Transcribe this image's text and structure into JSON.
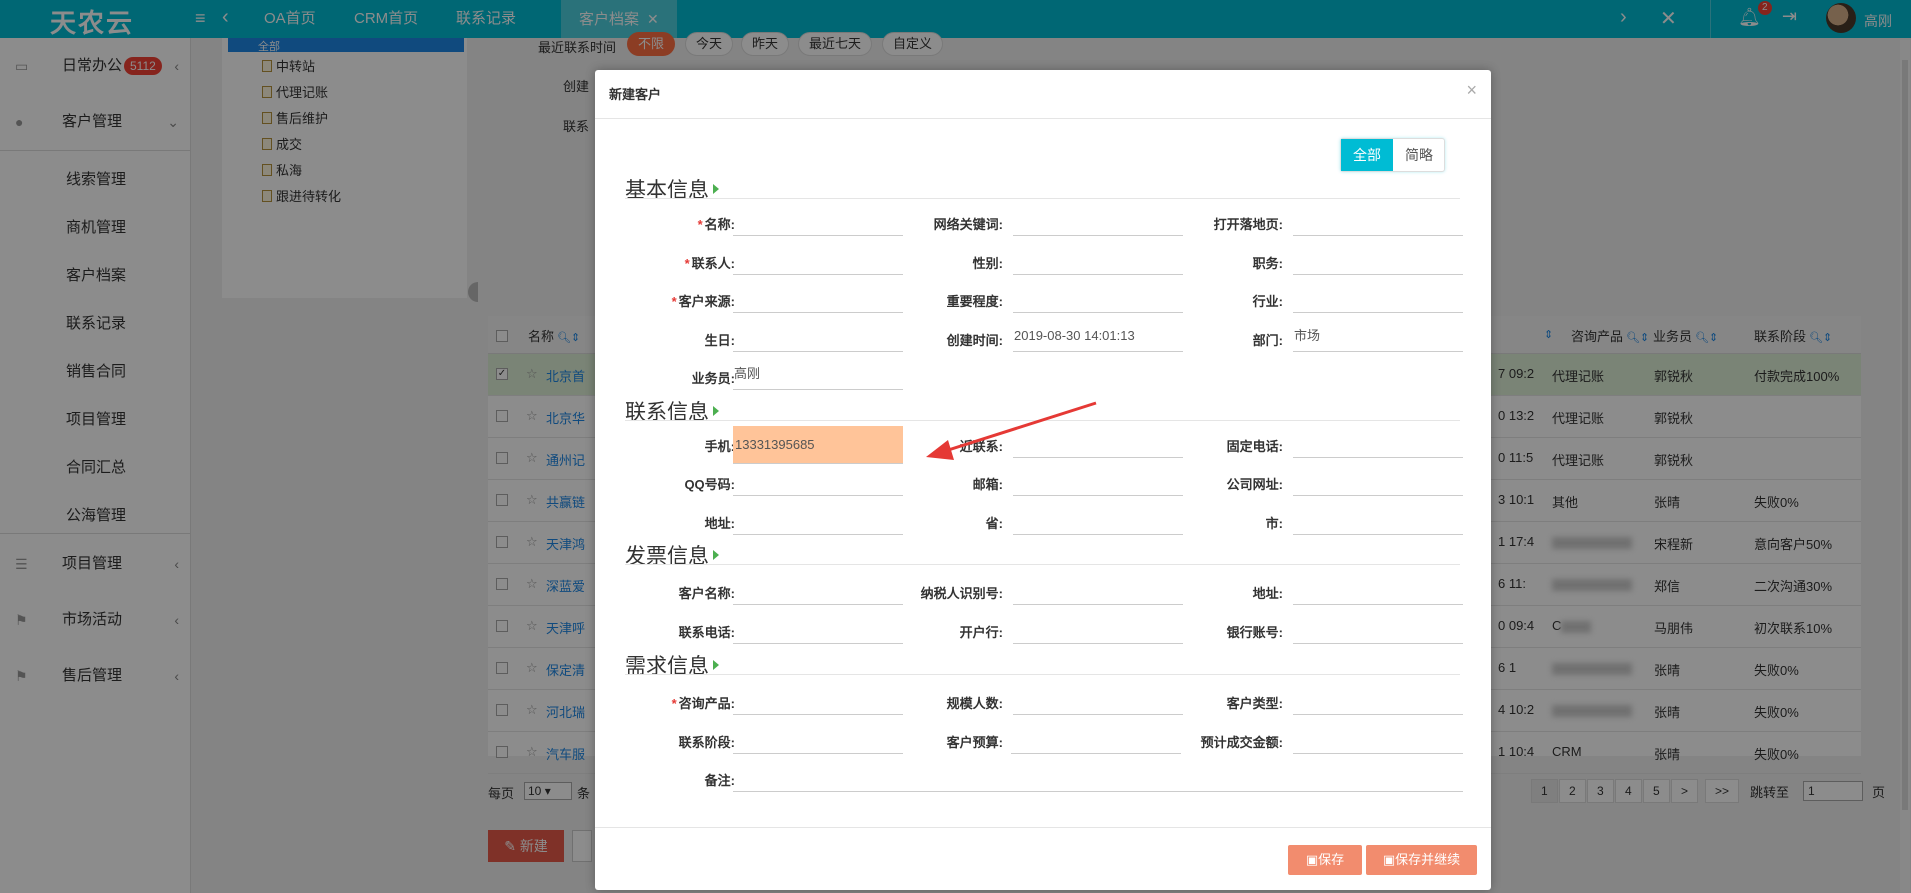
{
  "app": {
    "logo": "天农云",
    "username": "高刚",
    "notif_count": "2"
  },
  "tabs": [
    {
      "label": "OA首页"
    },
    {
      "label": "CRM首页"
    },
    {
      "label": "联系记录"
    },
    {
      "label": "客户档案"
    }
  ],
  "sidebar": {
    "groups": [
      {
        "label": "日常办公",
        "badge": "5112"
      },
      {
        "label": "客户管理"
      },
      {
        "label": "项目管理"
      },
      {
        "label": "市场活动"
      },
      {
        "label": "售后管理"
      }
    ],
    "sub_items": [
      "线索管理",
      "商机管理",
      "客户档案",
      "联系记录",
      "销售合同",
      "项目管理",
      "合同汇总",
      "公海管理"
    ]
  },
  "tree": {
    "selected": "全部",
    "items": [
      "中转站",
      "代理记账",
      "售后维护",
      "成交",
      "私海",
      "跟进待转化"
    ]
  },
  "filters": {
    "recent_contact_label": "最近联系时间",
    "chips": [
      "不限",
      "今天",
      "昨天",
      "最近七天",
      "自定义"
    ],
    "created_label": "创建",
    "contact_label": "联系"
  },
  "table": {
    "headers": [
      "名称",
      "咨询产品",
      "业务员",
      "联系阶段"
    ],
    "rows": [
      {
        "name": "北京首",
        "time": "7 09:2",
        "product": "代理记账",
        "sales": "郭锐秋",
        "stage": "付款完成100%"
      },
      {
        "name": "北京华",
        "time": "0 13:2",
        "product": "代理记账",
        "sales": "郭锐秋",
        "stage": ""
      },
      {
        "name": "通州记",
        "time": "0 11:5",
        "product": "代理记账",
        "sales": "郭锐秋",
        "stage": ""
      },
      {
        "name": "共赢链",
        "time": "3 10:1",
        "product": "其他",
        "sales": "张晴",
        "stage": "失败0%"
      },
      {
        "name": "天津鸿",
        "time": "1 17:4",
        "product": "",
        "sales": "宋程新",
        "stage": "意向客户50%"
      },
      {
        "name": "深蓝爱",
        "time": "6 11:",
        "product": "",
        "sales": "郑信",
        "stage": "二次沟通30%"
      },
      {
        "name": "天津呼",
        "time": "0 09:4",
        "product": "C",
        "sales": "马朋伟",
        "stage": "初次联系10%"
      },
      {
        "name": "保定清",
        "time": "6 1",
        "product": "",
        "sales": "张晴",
        "stage": "失败0%"
      },
      {
        "name": "河北瑞",
        "time": "4 10:2",
        "product": "",
        "sales": "张晴",
        "stage": "失败0%"
      },
      {
        "name": "汽车服",
        "time": "1 10:4",
        "product": "CRM",
        "sales": "张晴",
        "stage": "失败0%"
      }
    ]
  },
  "pager": {
    "per_page_label": "每页",
    "per_page_value": "10",
    "items_label": "条",
    "pages": [
      "1",
      "2",
      "3",
      "4",
      "5",
      ">",
      ">>"
    ],
    "jump_label": "跳转至",
    "jump_value": "1",
    "page_label": "页"
  },
  "new_button": "新建",
  "modal": {
    "title": "新建客户",
    "toggle_all": "全部",
    "toggle_brief": "简略",
    "sections": {
      "basic": "基本信息",
      "contact": "联系信息",
      "invoice": "发票信息",
      "demand": "需求信息"
    },
    "fields": {
      "name": "名称:",
      "keyword": "网络关键词:",
      "landing": "打开落地页:",
      "contact_person": "联系人:",
      "gender": "性别:",
      "position": "职务:",
      "source": "客户来源:",
      "importance": "重要程度:",
      "industry": "行业:",
      "birthday": "生日:",
      "created_time": "创建时间:",
      "created_time_value": "2019-08-30 14:01:13",
      "department": "部门:",
      "department_value": "市场",
      "salesman": "业务员:",
      "salesman_value": "高刚",
      "mobile": "手机:",
      "mobile_value": "13331395685",
      "recent_contact": "近联系:",
      "landline": "固定电话:",
      "qq": "QQ号码:",
      "email": "邮箱:",
      "website": "公司网址:",
      "address": "地址:",
      "province": "省:",
      "city": "市:",
      "inv_customer": "客户名称:",
      "tax_id": "纳税人识别号:",
      "inv_address": "地址:",
      "inv_phone": "联系电话:",
      "bank": "开户行:",
      "bank_account": "银行账号:",
      "product": "咨询产品:",
      "scale": "规模人数:",
      "customer_type": "客户类型:",
      "stage": "联系阶段:",
      "budget": "客户预算:",
      "expected_amount": "预计成交金额:",
      "remark": "备注:"
    },
    "save": "保存",
    "save_continue": "保存并继续"
  },
  "colors": {
    "primary": "#00bcd4",
    "accent_button": "#f28c6e",
    "highlight": "#ffc499",
    "arrow": "#e53935"
  }
}
